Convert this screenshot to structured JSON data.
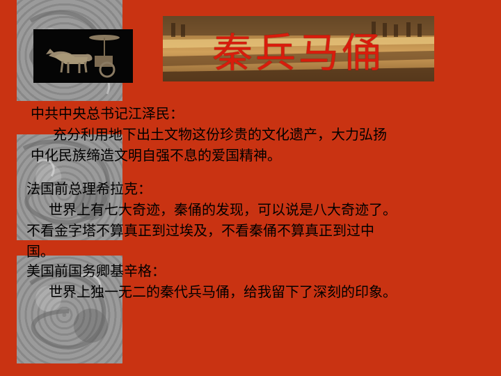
{
  "title": "秦兵马俑",
  "quotes": [
    {
      "speaker": "中共中央总书记江泽民：",
      "lines": [
        "充分利用地下出土文物这份珍贵的文化遗产，大力弘扬",
        "中化民族缔造文明自强不息的爱国精神。"
      ]
    },
    {
      "speaker": "法国前总理希拉克：",
      "lines": [
        "世界上有七大奇迹，秦俑的发现，可以说是八大奇迹了。",
        "不看金字塔不算真正到过埃及，不看秦俑不算真正到过中",
        "国。"
      ]
    },
    {
      "speaker": "美国前国务卿基辛格：",
      "lines": [
        "世界上独一无二的秦代兵马俑，给我留下了深刻的印象。"
      ]
    }
  ],
  "colors": {
    "background": "#c93312",
    "title": "#d81c0c",
    "panel": "#9b9b9b"
  }
}
